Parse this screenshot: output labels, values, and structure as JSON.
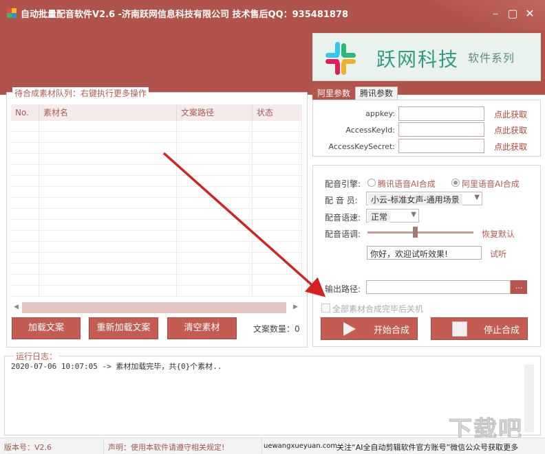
{
  "window": {
    "title": "自动批量配音软件V2.6 -济南跃网信息科技有限公司 技术售后QQ：935481878"
  },
  "logo": {
    "text": "跃网科技",
    "subtext": "软件系列"
  },
  "queue": {
    "group_title": "待合成素材队列：右键执行更多操作",
    "columns": [
      "No.",
      "素材名",
      "文案路径",
      "状态"
    ],
    "rows": []
  },
  "buttons": {
    "load": "加载文案",
    "reload": "重新加载文案",
    "clear": "清空素材",
    "start": "开始合成",
    "stop": "停止合成",
    "browse": "..."
  },
  "count": {
    "label": "文案数量：",
    "value": "0"
  },
  "tabs": [
    {
      "label": "阿里参数",
      "active": true
    },
    {
      "label": "腾讯参数",
      "active": false
    }
  ],
  "ali": {
    "fields": [
      {
        "label": "appkey:",
        "value": "",
        "link": "点此获取"
      },
      {
        "label": "AccessKeyId:",
        "value": "",
        "link": "点此获取"
      },
      {
        "label": "AccessKeySecret:",
        "value": "",
        "link": "点此获取"
      }
    ]
  },
  "config": {
    "engine_label": "配音引擎:",
    "engine_options": [
      {
        "label": "腾讯语音AI合成",
        "selected": false
      },
      {
        "label": "阿里语音AI合成",
        "selected": true
      }
    ],
    "voice_label": "配 音 员:",
    "voice_value": "小云-标准女声-通用场景",
    "speed_label": "配音语速:",
    "speed_value": "正常",
    "tone_label": "配音语调:",
    "tone_level": 0.45,
    "restore_label": "恢复默认",
    "test_text": "你好，欢迎试听效果!",
    "listen_label": "试听",
    "output_label": "输出路径:",
    "output_value": "",
    "shutdown_label": "全部素材合成完毕后关机"
  },
  "log": {
    "title": "运行日志：",
    "lines": [
      "2020-07-06 10:07:05 -> 素材加载完毕，共{0}个素材.."
    ]
  },
  "status": {
    "version": "版本号：V2.6",
    "notice": "声明：使用本软件请遵守相关规定!",
    "url": "uewangxueyuan.com",
    "promo": "关注“AI全自动剪辑软件官方账号”微信公众号获取更多"
  },
  "colors": {
    "brand": "#b0534a",
    "button": "#c45c52",
    "logo_text": "#2f9c83"
  }
}
